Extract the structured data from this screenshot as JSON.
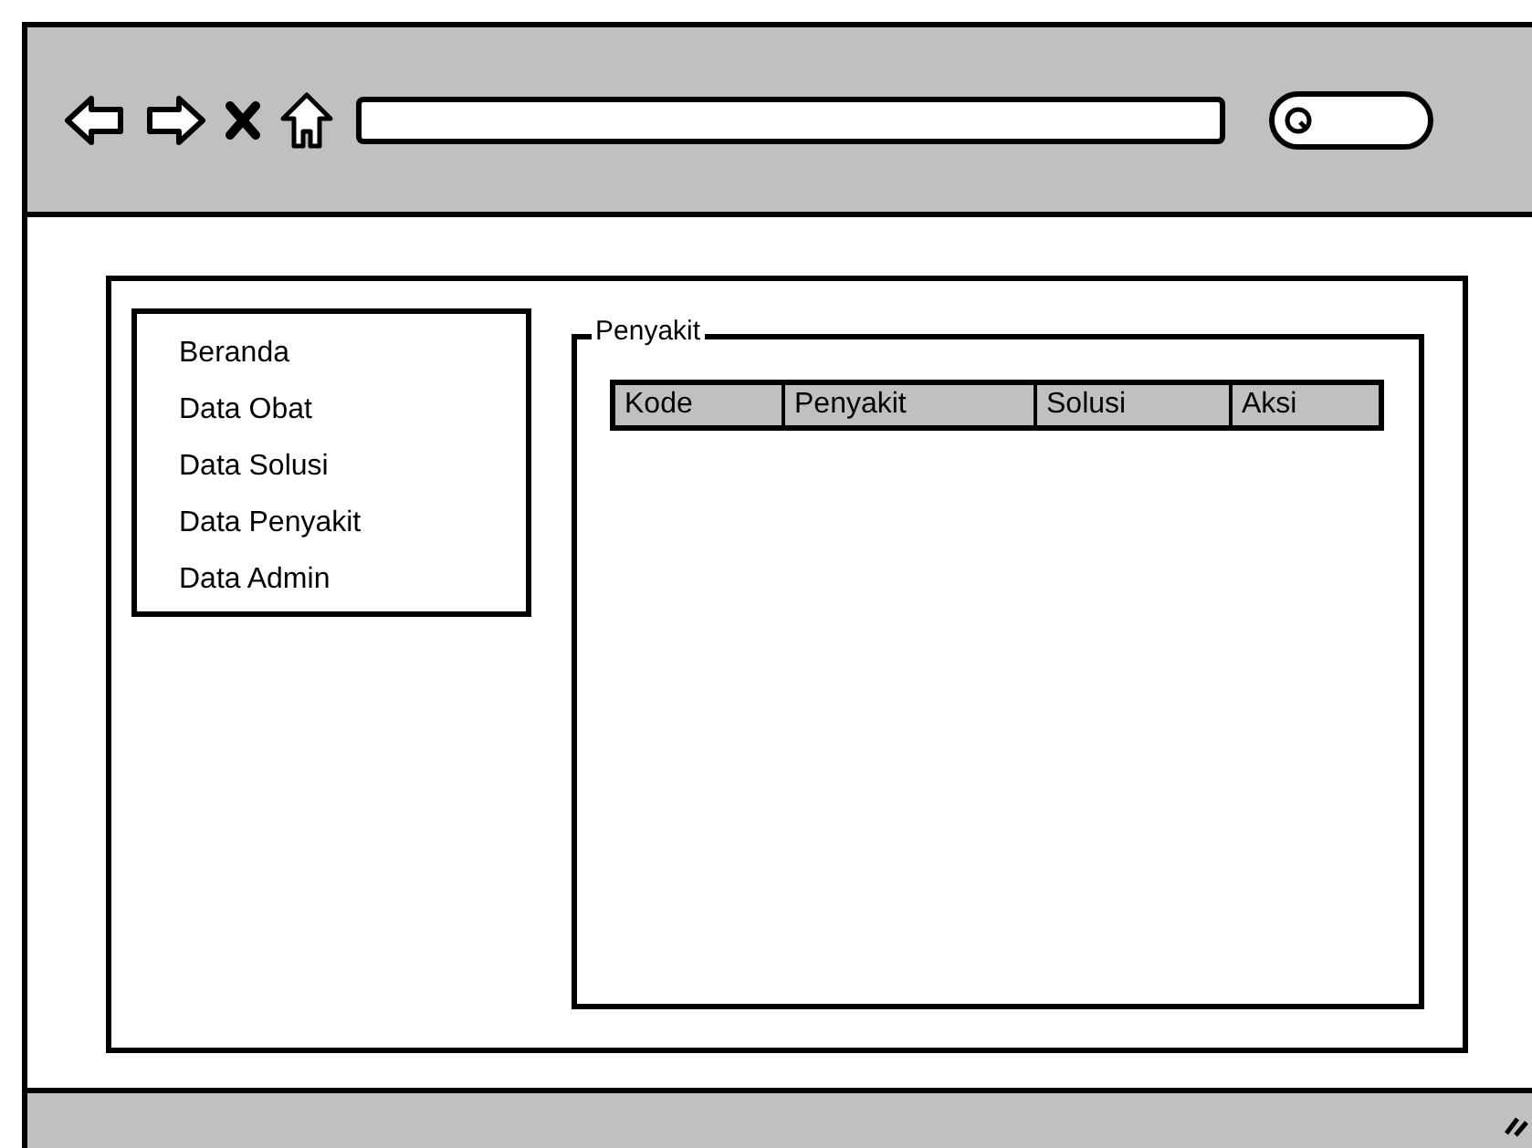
{
  "sidebar": {
    "items": [
      {
        "label": "Beranda"
      },
      {
        "label": "Data Obat"
      },
      {
        "label": "Data Solusi"
      },
      {
        "label": "Data Penyakit"
      },
      {
        "label": "Data Admin"
      }
    ]
  },
  "group": {
    "title": "Penyakit"
  },
  "table": {
    "columns": [
      "Kode",
      "Penyakit",
      "Solusi",
      "Aksi"
    ]
  }
}
